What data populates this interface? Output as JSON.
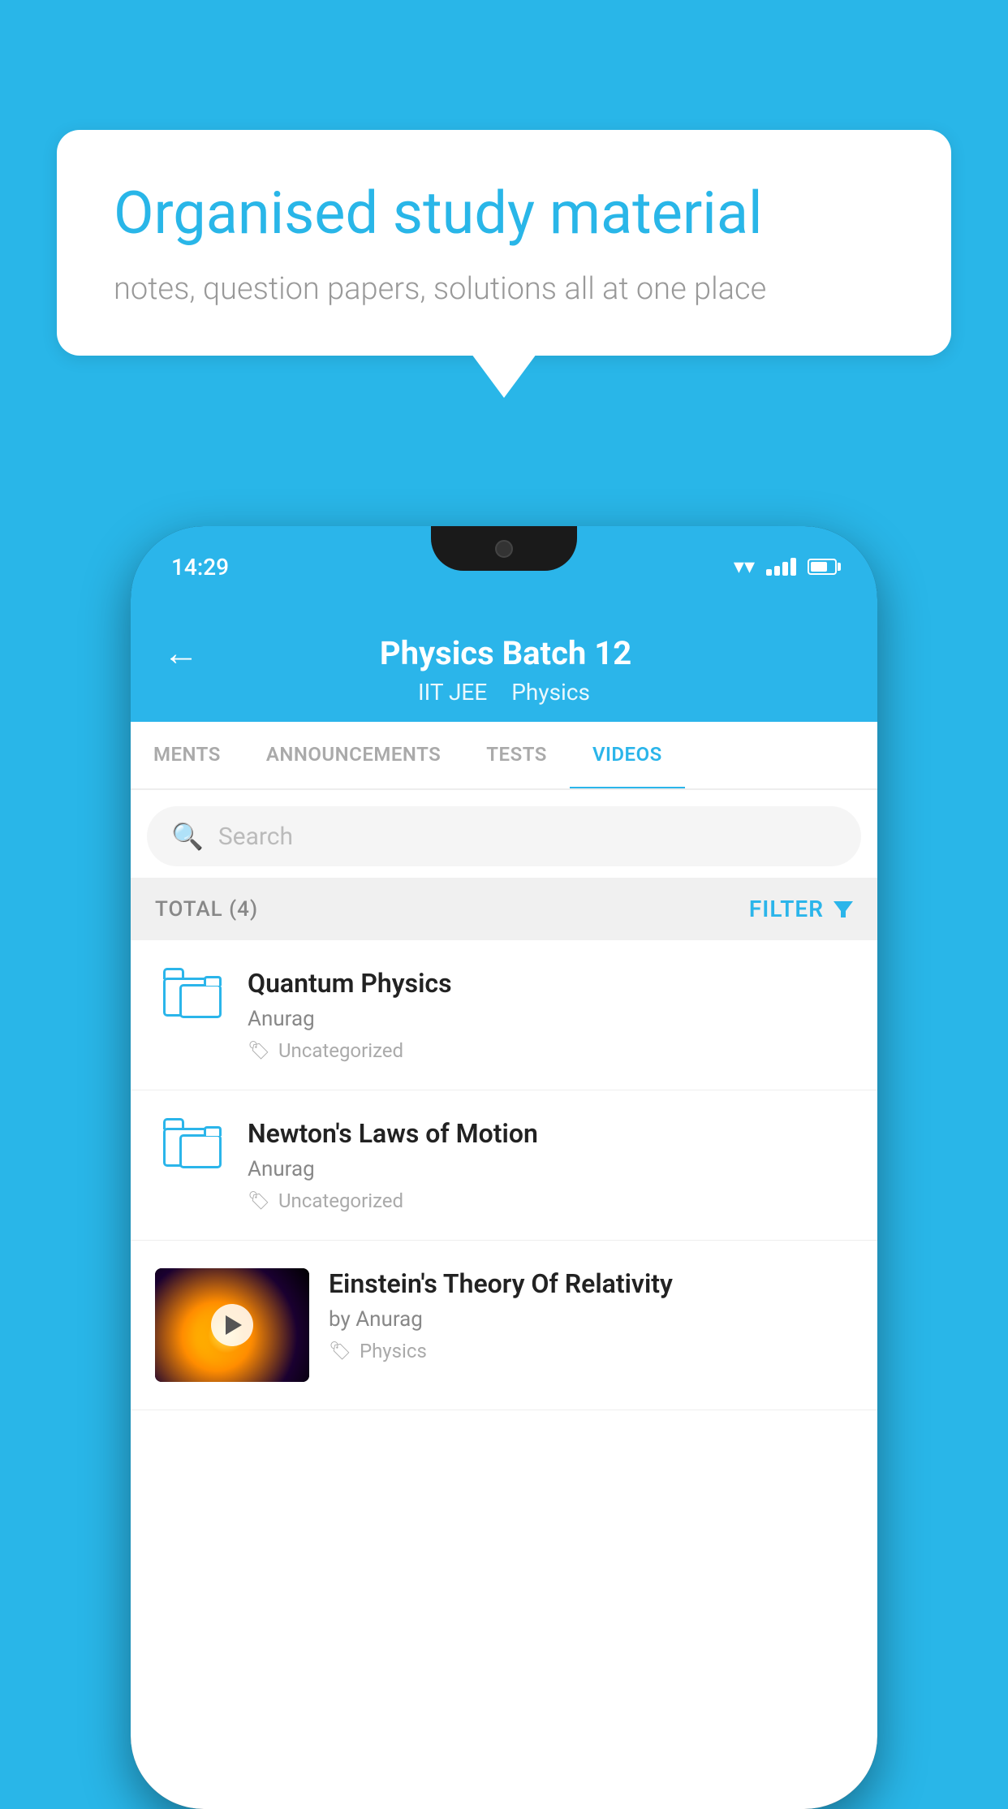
{
  "background_color": "#29b6e8",
  "speech_bubble": {
    "heading": "Organised study material",
    "subtext": "notes, question papers, solutions all at one place"
  },
  "phone": {
    "status_bar": {
      "time": "14:29"
    },
    "app_header": {
      "title": "Physics Batch 12",
      "subtitle1": "IIT JEE",
      "subtitle2": "Physics",
      "back_label": "←"
    },
    "tabs": [
      {
        "label": "MENTS",
        "active": false
      },
      {
        "label": "ANNOUNCEMENTS",
        "active": false
      },
      {
        "label": "TESTS",
        "active": false
      },
      {
        "label": "VIDEOS",
        "active": true
      }
    ],
    "search": {
      "placeholder": "Search"
    },
    "filter_bar": {
      "total_label": "TOTAL (4)",
      "filter_label": "FILTER"
    },
    "videos": [
      {
        "id": 1,
        "title": "Quantum Physics",
        "author": "Anurag",
        "tag": "Uncategorized",
        "has_thumbnail": false
      },
      {
        "id": 2,
        "title": "Newton's Laws of Motion",
        "author": "Anurag",
        "tag": "Uncategorized",
        "has_thumbnail": false
      },
      {
        "id": 3,
        "title": "Einstein's Theory Of Relativity",
        "author": "by Anurag",
        "tag": "Physics",
        "has_thumbnail": true
      }
    ]
  }
}
